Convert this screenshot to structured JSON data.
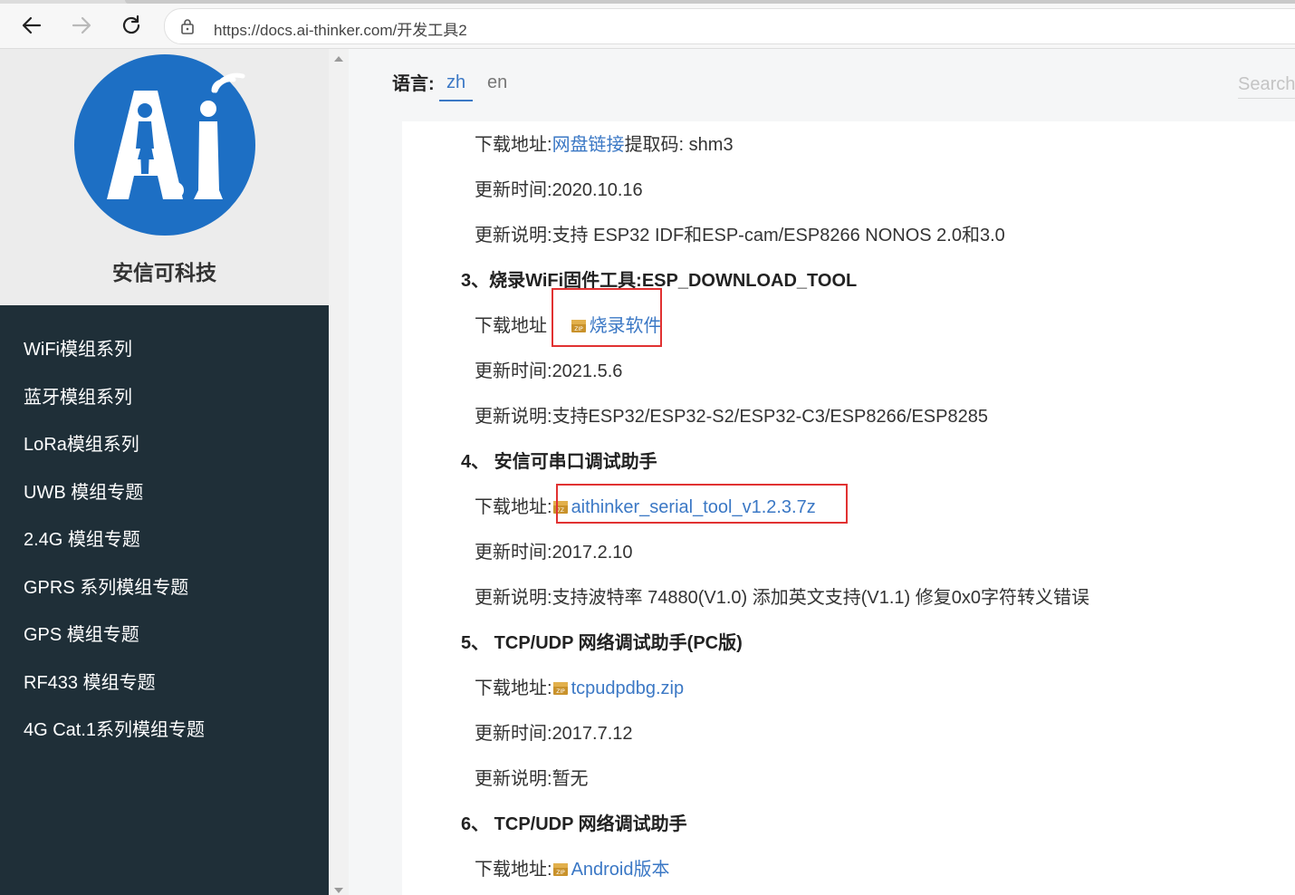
{
  "browser": {
    "url": "https://docs.ai-thinker.com/开发工具2"
  },
  "sidebar": {
    "brand_name": "安信可科技",
    "logo_text": "A.I",
    "items": [
      {
        "label": "WiFi模组系列"
      },
      {
        "label": "蓝牙模组系列"
      },
      {
        "label": "LoRa模组系列"
      },
      {
        "label": "UWB 模组专题"
      },
      {
        "label": "2.4G 模组专题"
      },
      {
        "label": "GPRS 系列模组专题"
      },
      {
        "label": "GPS 模组专题"
      },
      {
        "label": "RF433 模组专题"
      },
      {
        "label": "4G Cat.1系列模组专题"
      }
    ]
  },
  "header": {
    "lang_label": "语言:",
    "lang_zh": "zh",
    "lang_en": "en",
    "search_placeholder": "Search"
  },
  "content": {
    "r1": {
      "label": "下载地址:",
      "link": "网盘链接",
      "suffix": "提取码:  shm3"
    },
    "r2": {
      "label": "更新时间:",
      "value": "2020.10.16"
    },
    "r3": {
      "label": "更新说明:",
      "value": "支持 ESP32 IDF和ESP-cam/ESP8266 NONOS 2.0和3.0"
    },
    "h3": "3、烧录WiFi固件工具:ESP_DOWNLOAD_TOOL",
    "r4": {
      "label": "下载地址",
      "link": "烧录软件"
    },
    "r5": {
      "label": "更新时间:",
      "value": "2021.5.6"
    },
    "r6": {
      "label": "更新说明:",
      "value": "支持ESP32/ESP32-S2/ESP32-C3/ESP8266/ESP8285"
    },
    "h4": "4、 安信可串口调试助手",
    "r7": {
      "label": "下载地址:",
      "link": "aithinker_serial_tool_v1.2.3.7z"
    },
    "r8": {
      "label": "更新时间:",
      "value": "2017.2.10"
    },
    "r9": {
      "label": "更新说明:",
      "value": "支持波特率 74880(V1.0) 添加英文支持(V1.1) 修复0x0字符转义错误"
    },
    "h5": "5、 TCP/UDP 网络调试助手(PC版)",
    "r10": {
      "label": "下载地址:",
      "link": "tcpudpdbg.zip"
    },
    "r11": {
      "label": "更新时间:",
      "value": "2017.7.12"
    },
    "r12": {
      "label": "更新说明:",
      "value": "暂无"
    },
    "h6": "6、 TCP/UDP 网络调试助手",
    "r13": {
      "label": "下载地址:",
      "link": "Android版本"
    }
  },
  "colors": {
    "link": "#3b78c5",
    "sidebar_bg": "#1f2f38",
    "highlight_box": "#e13232",
    "logo_blue": "#1d6fc4"
  }
}
